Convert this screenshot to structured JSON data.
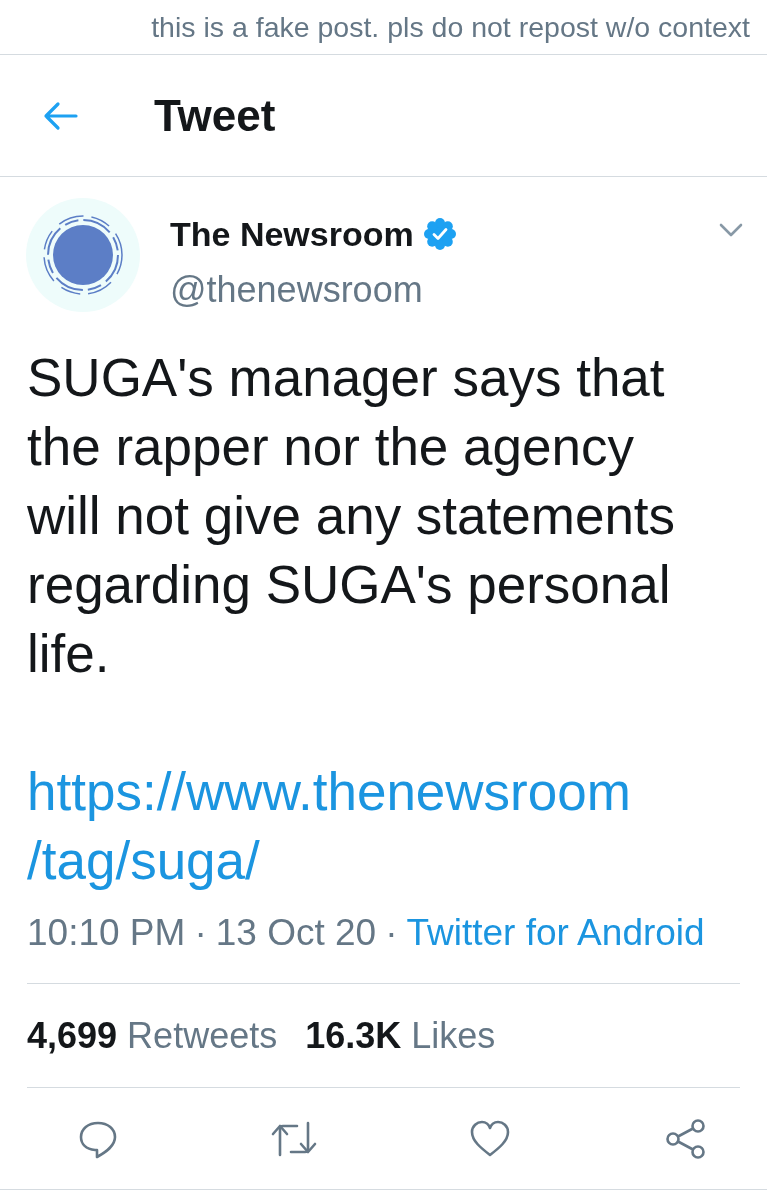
{
  "note": "this is a fake post. pls do not repost w/o context",
  "header": {
    "title": "Tweet"
  },
  "author": {
    "name": "The Newsroom",
    "verified": true,
    "handle": "@thenewsroom"
  },
  "tweet": {
    "text": "SUGA's manager says that the rapper nor the agency will not give any statements regarding SUGA's personal life.",
    "link": "https://www.thenewsroom/tag/suga/"
  },
  "meta": [
    {
      "kind": "text",
      "text": "10:10 PM"
    },
    {
      "kind": "separator",
      "text": "·"
    },
    {
      "kind": "text",
      "text": "13 Oct 20"
    },
    {
      "kind": "separator",
      "text": "·"
    },
    {
      "kind": "link",
      "text": "Twitter for Android"
    }
  ],
  "stats": [
    {
      "count": "4,699",
      "label": "Retweets"
    },
    {
      "count": "16.3K",
      "label": "Likes"
    }
  ],
  "actions": [
    {
      "kind": "reply"
    },
    {
      "kind": "retweet"
    },
    {
      "kind": "like"
    },
    {
      "kind": "share"
    }
  ]
}
